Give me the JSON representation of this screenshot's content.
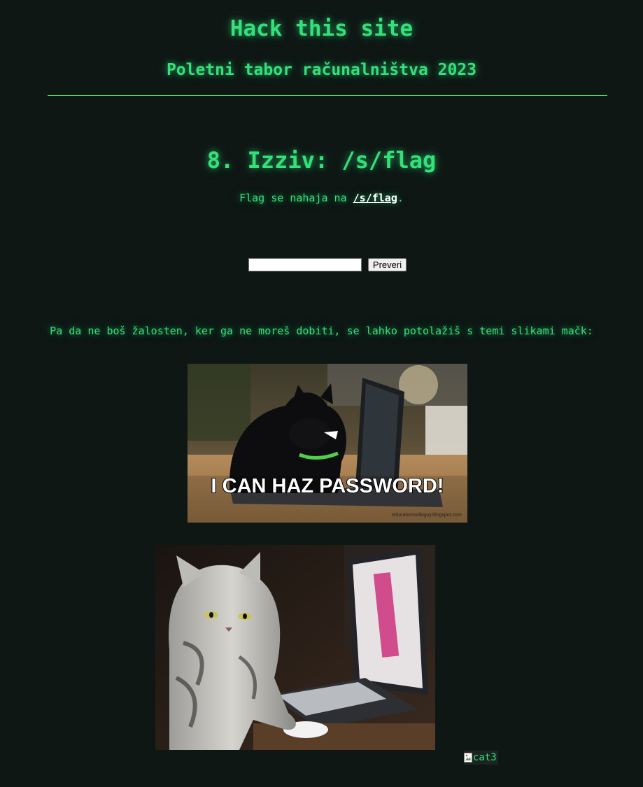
{
  "header": {
    "title": "Hack this site",
    "subtitle": "Poletni tabor računalništva 2023"
  },
  "challenge": {
    "title": "8. Izziv: /s/flag",
    "desc_prefix": "Flag se nahaja na ",
    "desc_link": "/s/flag",
    "desc_suffix": "."
  },
  "form": {
    "input_value": "",
    "button_label": "Preveri"
  },
  "consolation": {
    "text": "Pa da ne boš žalosten, ker ga ne moreš dobiti, se lahko potolažiš s temi slikami mačk:"
  },
  "images": {
    "cat1_caption": "I CAN HAZ PASSWORD!",
    "cat1_watermark": "educatorssolloguy.blogspot.com",
    "cat3_alt": "cat3"
  },
  "colors": {
    "background": "#0f1715",
    "accent": "#33e07a",
    "link": "#ffffff"
  }
}
